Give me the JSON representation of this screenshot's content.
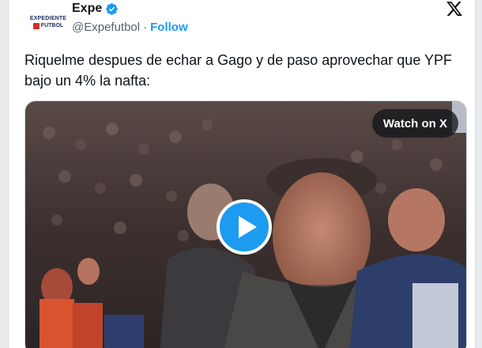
{
  "author": {
    "avatar_line1": "EXPEDIENTE",
    "avatar_line2": "FUTBOL",
    "display_name": "Expe",
    "handle": "@Expefutbol",
    "separator": "·",
    "follow_label": "Follow"
  },
  "tweet": {
    "text": "Riquelme despues de echar a Gago y de paso aprovechar que YPF bajo un 4% la nafta:"
  },
  "media": {
    "watch_label": "Watch on X"
  },
  "icons": {
    "verified": "verified-badge-icon",
    "platform": "x-logo-icon",
    "play": "play-icon"
  },
  "colors": {
    "accent": "#1d9bf0",
    "text": "#0f1419",
    "muted": "#536471"
  }
}
